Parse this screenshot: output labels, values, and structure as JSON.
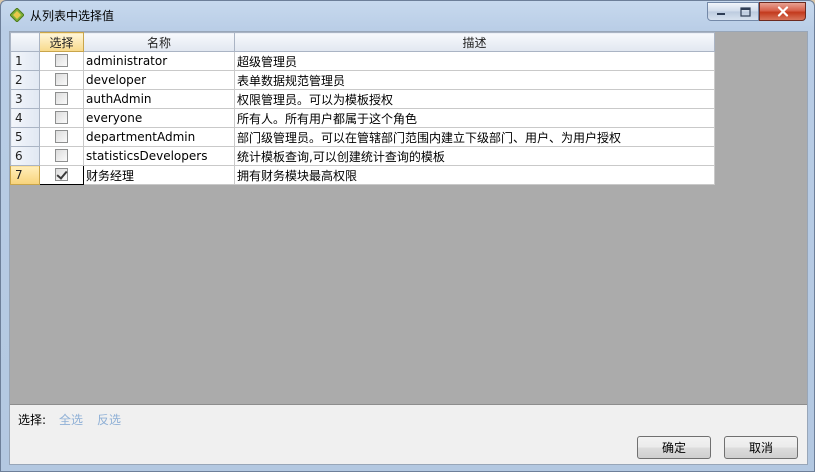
{
  "window": {
    "title": "从列表中选择值",
    "colors": {
      "title_bar": "#c7d9ee",
      "close_button": "#c33a1d"
    }
  },
  "grid": {
    "columns": {
      "select": "选择",
      "name": "名称",
      "description": "描述"
    },
    "rows": [
      {
        "num": "1",
        "checked": false,
        "name": "administrator",
        "description": "超级管理员"
      },
      {
        "num": "2",
        "checked": false,
        "name": "developer",
        "description": "表单数据规范管理员"
      },
      {
        "num": "3",
        "checked": false,
        "name": "authAdmin",
        "description": "权限管理员。可以为模板授权"
      },
      {
        "num": "4",
        "checked": false,
        "name": "everyone",
        "description": "所有人。所有用户都属于这个角色"
      },
      {
        "num": "5",
        "checked": false,
        "name": "departmentAdmin",
        "description": "部门级管理员。可以在管辖部门范围内建立下级部门、用户、为用户授权"
      },
      {
        "num": "6",
        "checked": false,
        "name": "statisticsDevelopers",
        "description": "统计模板查询,可以创建统计查询的模板"
      },
      {
        "num": "7",
        "checked": true,
        "name": "财务经理",
        "description": "拥有财务模块最高权限"
      }
    ],
    "active_row": "7"
  },
  "footer": {
    "select_label": "选择:",
    "select_all": "全选",
    "invert_selection": "反选",
    "ok_button": "确定",
    "cancel_button": "取消",
    "link_color": "#8fb0d6"
  }
}
